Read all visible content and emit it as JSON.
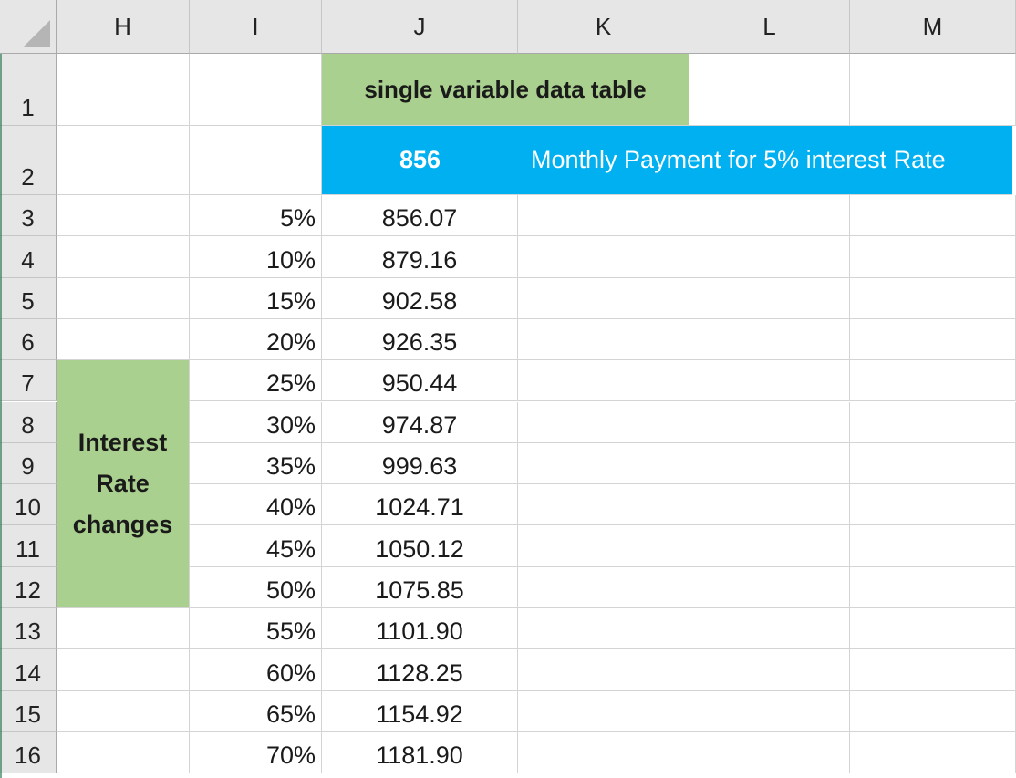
{
  "columns": [
    "H",
    "I",
    "J",
    "K",
    "L",
    "M"
  ],
  "rows": [
    "1",
    "2",
    "3",
    "4",
    "5",
    "6",
    "7",
    "8",
    "9",
    "10",
    "11",
    "12",
    "13",
    "14",
    "15",
    "16"
  ],
  "title": "single variable data table",
  "formula_result": "856",
  "formula_note": "Monthly Payment for 5% interest Rate",
  "rate_label_lines": [
    "Interest",
    "Rate",
    "changes"
  ],
  "table": [
    {
      "rate": "5%",
      "payment": "856.07"
    },
    {
      "rate": "10%",
      "payment": "879.16"
    },
    {
      "rate": "15%",
      "payment": "902.58"
    },
    {
      "rate": "20%",
      "payment": "926.35"
    },
    {
      "rate": "25%",
      "payment": "950.44"
    },
    {
      "rate": "30%",
      "payment": "974.87"
    },
    {
      "rate": "35%",
      "payment": "999.63"
    },
    {
      "rate": "40%",
      "payment": "1024.71"
    },
    {
      "rate": "45%",
      "payment": "1050.12"
    },
    {
      "rate": "50%",
      "payment": "1075.85"
    },
    {
      "rate": "55%",
      "payment": "1101.90"
    },
    {
      "rate": "60%",
      "payment": "1128.25"
    },
    {
      "rate": "65%",
      "payment": "1154.92"
    },
    {
      "rate": "70%",
      "payment": "1181.90"
    }
  ],
  "colors": {
    "green_fill": "#a9d08e",
    "blue_fill": "#00b0f0"
  }
}
